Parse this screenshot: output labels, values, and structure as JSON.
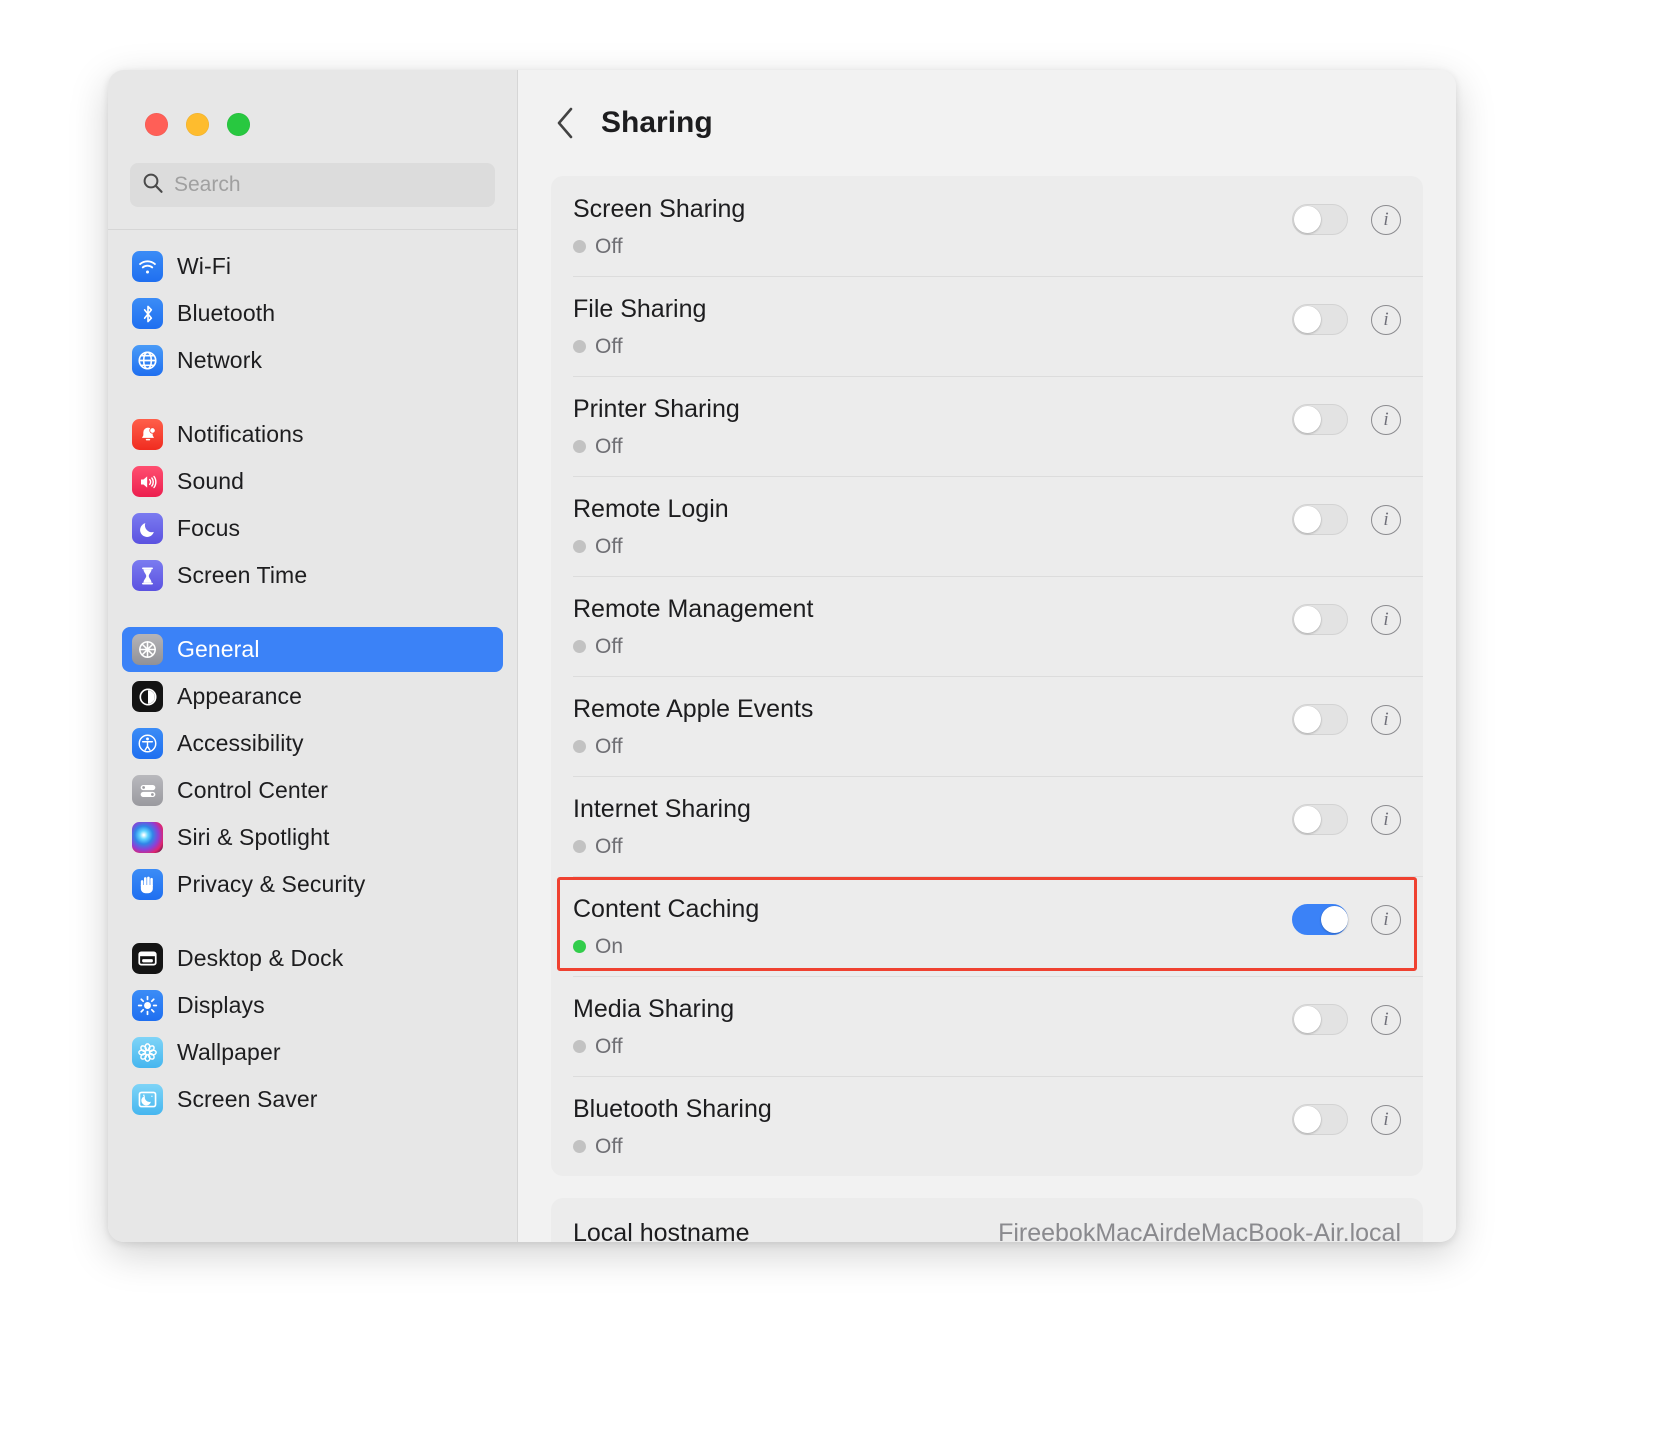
{
  "window": {
    "traffic_lights": [
      {
        "name": "close",
        "color": "#ff5f57"
      },
      {
        "name": "minimize",
        "color": "#febc2e"
      },
      {
        "name": "zoom",
        "color": "#28c840"
      }
    ]
  },
  "search": {
    "placeholder": "Search",
    "value": "",
    "icon": "search-icon"
  },
  "sidebar": {
    "groups": [
      {
        "items": [
          {
            "label": "Wi-Fi",
            "icon": "wifi-icon",
            "selected": false
          },
          {
            "label": "Bluetooth",
            "icon": "bluetooth-icon",
            "selected": false
          },
          {
            "label": "Network",
            "icon": "network-globe-icon",
            "selected": false
          }
        ]
      },
      {
        "items": [
          {
            "label": "Notifications",
            "icon": "notifications-bell-icon",
            "selected": false
          },
          {
            "label": "Sound",
            "icon": "sound-speaker-icon",
            "selected": false
          },
          {
            "label": "Focus",
            "icon": "focus-moon-icon",
            "selected": false
          },
          {
            "label": "Screen Time",
            "icon": "screen-time-hourglass-icon",
            "selected": false
          }
        ]
      },
      {
        "items": [
          {
            "label": "General",
            "icon": "general-gear-icon",
            "selected": true
          },
          {
            "label": "Appearance",
            "icon": "appearance-icon",
            "selected": false
          },
          {
            "label": "Accessibility",
            "icon": "accessibility-icon",
            "selected": false
          },
          {
            "label": "Control Center",
            "icon": "control-center-icon",
            "selected": false
          },
          {
            "label": "Siri & Spotlight",
            "icon": "siri-icon",
            "selected": false
          },
          {
            "label": "Privacy & Security",
            "icon": "privacy-hand-icon",
            "selected": false
          }
        ]
      },
      {
        "items": [
          {
            "label": "Desktop & Dock",
            "icon": "desktop-dock-icon",
            "selected": false
          },
          {
            "label": "Displays",
            "icon": "displays-brightness-icon",
            "selected": false
          },
          {
            "label": "Wallpaper",
            "icon": "wallpaper-flower-icon",
            "selected": false
          },
          {
            "label": "Screen Saver",
            "icon": "screen-saver-icon",
            "selected": false
          }
        ]
      }
    ]
  },
  "detail": {
    "back_label": "",
    "title": "Sharing",
    "services": [
      {
        "name": "Screen Sharing",
        "status": "Off",
        "on": false
      },
      {
        "name": "File Sharing",
        "status": "Off",
        "on": false
      },
      {
        "name": "Printer Sharing",
        "status": "Off",
        "on": false
      },
      {
        "name": "Remote Login",
        "status": "Off",
        "on": false
      },
      {
        "name": "Remote Management",
        "status": "Off",
        "on": false
      },
      {
        "name": "Remote Apple Events",
        "status": "Off",
        "on": false
      },
      {
        "name": "Internet Sharing",
        "status": "Off",
        "on": false
      },
      {
        "name": "Content Caching",
        "status": "On",
        "on": true,
        "highlighted": true
      },
      {
        "name": "Media Sharing",
        "status": "Off",
        "on": false
      },
      {
        "name": "Bluetooth Sharing",
        "status": "Off",
        "on": false
      }
    ],
    "info_glyph": "i",
    "hostname_row": {
      "label": "Local hostname",
      "value": "FireebokMacAirdeMacBook-Air.local"
    }
  },
  "colors": {
    "accent_blue": "#3b82f7",
    "status_on_green": "#32cd4b",
    "status_off_gray": "#c2c2c2",
    "highlight_red": "#ef4130"
  }
}
